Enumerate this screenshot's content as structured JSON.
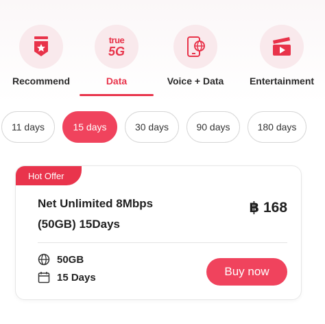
{
  "categories": [
    {
      "label": "Recommend",
      "icon": "shield-star-icon"
    },
    {
      "label": "Data",
      "icon": "true-5g-logo",
      "logo_line1": "true",
      "logo_line2": "5G"
    },
    {
      "label": "Voice + Data",
      "icon": "phone-globe-icon"
    },
    {
      "label": "Entertainment",
      "icon": "clapperboard-icon"
    }
  ],
  "active_category": "Data",
  "durations": [
    "11 days",
    "15 days",
    "30 days",
    "90 days",
    "180 days"
  ],
  "active_duration": "15 days",
  "offer": {
    "badge": "Hot Offer",
    "name_line1": "Net Unlimited 8Mbps",
    "name_line2": "(50GB) 15Days",
    "price": "฿ 168",
    "feature_data": "50GB",
    "feature_days": "15 Days",
    "buy_label": "Buy now"
  },
  "colors": {
    "accent": "#f0435d",
    "accent_dark": "#e8334a",
    "icon_bg": "#f9e9ec"
  }
}
